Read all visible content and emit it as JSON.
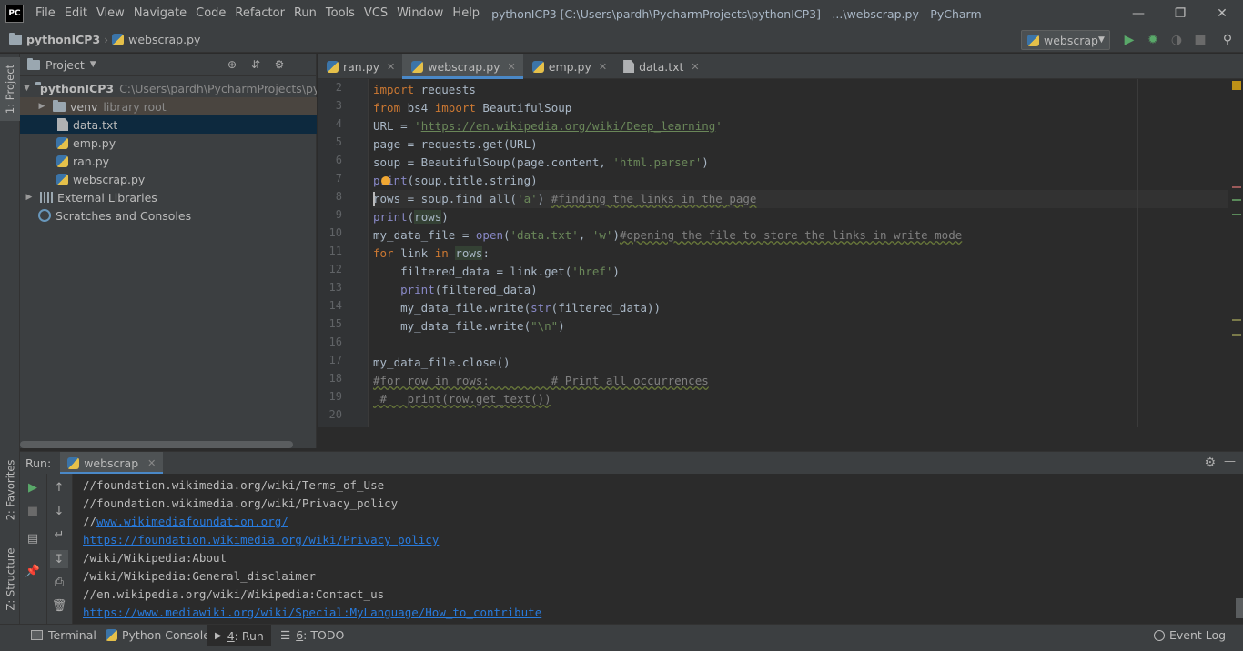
{
  "app": {
    "logo": "PC",
    "window_title": "pythonICP3 [C:\\Users\\pardh\\PycharmProjects\\pythonICP3] - ...\\webscrap.py - PyCharm",
    "menu": [
      "File",
      "Edit",
      "View",
      "Navigate",
      "Code",
      "Refactor",
      "Run",
      "Tools",
      "VCS",
      "Window",
      "Help"
    ]
  },
  "navbar": {
    "project": "pythonICP3",
    "file": "webscrap.py",
    "run_config": "webscrap"
  },
  "left_strip": {
    "project_tab": "1: Project",
    "favorites_tab": "2: Favorites",
    "structure_tab": "Z: Structure"
  },
  "project_panel": {
    "title": "Project",
    "root_name": "pythonICP3",
    "root_path": "C:\\Users\\pardh\\PycharmProjects\\python",
    "venv": "venv",
    "venv_note": "library root",
    "files": [
      "data.txt",
      "emp.py",
      "ran.py",
      "webscrap.py"
    ],
    "external": "External Libraries",
    "scratches": "Scratches and Consoles"
  },
  "editor_tabs": [
    "ran.py",
    "webscrap.py",
    "emp.py",
    "data.txt"
  ],
  "editor": {
    "line_numbers": [
      "2",
      "3",
      "4",
      "5",
      "6",
      "7",
      "8",
      "9",
      "10",
      "11",
      "12",
      "13",
      "14",
      "15",
      "16",
      "17",
      "18",
      "19",
      "20"
    ],
    "code": {
      "l2_kw": "import",
      "l2_rest": " requests",
      "l3_kw1": "from",
      "l3_mod": " bs4 ",
      "l3_kw2": "import",
      "l3_rest": " BeautifulSoup",
      "l4_pre": "URL = ",
      "l4_q1": "'",
      "l4_url": "https://en.wikipedia.org/wiki/Deep_learning",
      "l4_q2": "'",
      "l5": "page = requests.get(URL)",
      "l6_pre": "soup = BeautifulSoup(page.content, ",
      "l6_str": "'html.parser'",
      "l6_post": ")",
      "l7_bi": "print",
      "l7_rest": "(soup.title.string)",
      "l8_pre": "rows = soup.find_all(",
      "l8_str": "'a'",
      "l8_post": ") ",
      "l8_cm": "#finding the links in the page",
      "l9_bi": "print",
      "l9_p1": "(",
      "l9_var": "rows",
      "l9_p2": ")",
      "l10_pre": "my_data_file = ",
      "l10_bi": "open",
      "l10_p1": "(",
      "l10_s1": "'data.txt'",
      "l10_c": ", ",
      "l10_s2": "'w'",
      "l10_p2": ")",
      "l10_cm": "#opening the file to store the links in write mode",
      "l11_kw1": "for",
      "l11_mid": " link ",
      "l11_kw2": "in",
      "l11_sp": " ",
      "l11_var": "rows",
      "l11_end": ":",
      "l12_pre": "    filtered_data = link.get(",
      "l12_str": "'href'",
      "l12_post": ")",
      "l13_ind": "    ",
      "l13_bi": "print",
      "l13_rest": "(filtered_data)",
      "l14_pre": "    my_data_file.write(",
      "l14_bi": "str",
      "l14_rest": "(filtered_data))",
      "l15_pre": "    my_data_file.write(",
      "l15_str": "\"\\n\"",
      "l15_post": ")",
      "l17": "my_data_file.close()",
      "l18_cm": "#for row in rows:         # Print all occurrences",
      "l19_cm": " #   print(row.get_text())"
    }
  },
  "run_panel": {
    "label": "Run:",
    "tab": "webscrap",
    "output": [
      {
        "pre": "//foundation.wikimedia.org/wiki/Terms_of_Use",
        "link": ""
      },
      {
        "pre": "//foundation.wikimedia.org/wiki/Privacy_policy",
        "link": ""
      },
      {
        "pre": "//",
        "link": "www.wikimediafoundation.org/"
      },
      {
        "pre": "",
        "link": "https://foundation.wikimedia.org/wiki/Privacy_policy"
      },
      {
        "pre": "/wiki/Wikipedia:About",
        "link": ""
      },
      {
        "pre": "/wiki/Wikipedia:General_disclaimer",
        "link": ""
      },
      {
        "pre": "//en.wikipedia.org/wiki/Wikipedia:Contact_us",
        "link": ""
      },
      {
        "pre": "",
        "link": "https://www.mediawiki.org/wiki/Special:MyLanguage/How_to_contribute"
      }
    ]
  },
  "statusbar": {
    "terminal": "Terminal",
    "python_console": "Python Console",
    "run_num": "4",
    "run": ": Run",
    "todo_num": "6",
    "todo": ": TODO",
    "event_log": "Event Log"
  },
  "colors": {
    "accent": "#4a88c7",
    "keyword": "#cc7832",
    "string": "#6a8759",
    "link": "#287bde",
    "run_green": "#59a869"
  }
}
